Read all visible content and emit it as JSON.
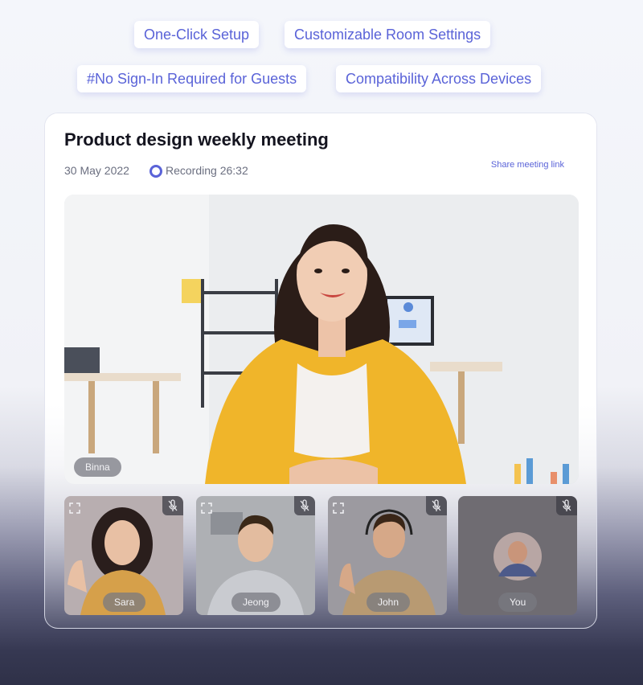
{
  "features": {
    "one_click": "One-Click Setup",
    "room_settings": "Customizable Room Settings",
    "no_signin": "#No Sign-In Required for Guests",
    "compat": "Compatibility Across Devices"
  },
  "meeting": {
    "title": "Product design weekly meeting",
    "date": "30 May 2022",
    "recording": "Recording 26:32",
    "share_link": "Share meeting link",
    "host_name": "Binna"
  },
  "participants": [
    {
      "name": "Sara"
    },
    {
      "name": "Jeong"
    },
    {
      "name": "John"
    },
    {
      "name": "You"
    }
  ],
  "colors": {
    "accent": "#5a63d8",
    "title": "#14141f"
  },
  "icons": {
    "recording": "record-dot-icon",
    "mute": "mic-off-icon",
    "expand": "expand-icon"
  }
}
